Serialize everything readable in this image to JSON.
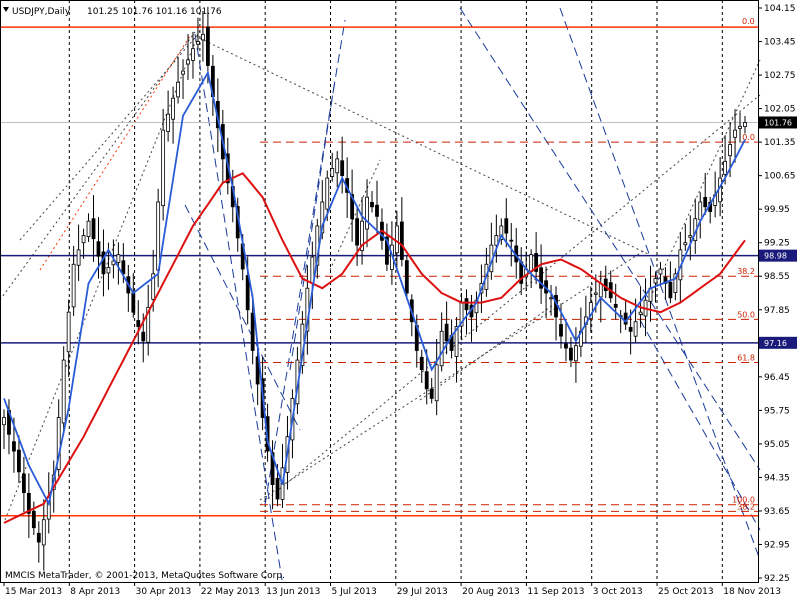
{
  "header": {
    "symbol": "USDJPY,Daily",
    "ohlc": "101.25 101.76 101.16 101.76"
  },
  "footer": {
    "copyright": "MMCIS MetaTrader, © 2001-2013, MetaQuotes Software Corp."
  },
  "colors": {
    "background": "#ffffff",
    "grid": "#000000",
    "candle": "#000000",
    "ma_fast": "#2a5bd7",
    "ma_slow": "#dd1111",
    "level_orange": "#ff3300",
    "level_navy": "#1a1a7a",
    "fibo_red": "#cc2200",
    "trend_blue": "#1a3a9a",
    "trend_dotted": "#444444"
  },
  "chart_data": {
    "type": "candlestick",
    "x_ticks": [
      "15 Mar 2013",
      "8 Apr 2013",
      "30 Apr 2013",
      "22 May 2013",
      "13 Jun 2013",
      "5 Jul 2013",
      "29 Jul 2013",
      "20 Aug 2013",
      "11 Sep 2013",
      "3 Oct 2013",
      "25 Oct 2013",
      "18 Nov 2013"
    ],
    "y_ticks": [
      "104.15",
      "103.45",
      "102.75",
      "102.05",
      "101.35",
      "100.65",
      "99.95",
      "99.25",
      "98.55",
      "97.85",
      "97.15",
      "96.45",
      "95.75",
      "95.05",
      "94.35",
      "93.65",
      "92.95",
      "92.25"
    ],
    "ylim": [
      92.25,
      104.15
    ],
    "current_price": "101.76",
    "price_badges": [
      {
        "label": "101.76",
        "value": 101.76,
        "color": "#000000"
      },
      {
        "label": "98.98",
        "value": 98.98,
        "color": "#1a1a7a"
      },
      {
        "label": "97.16",
        "value": 97.16,
        "color": "#1a1a7a"
      }
    ],
    "horizontal_levels": [
      {
        "value": 103.75,
        "color": "#ff3300",
        "style": "solid",
        "label": "0.0"
      },
      {
        "value": 93.55,
        "color": "#ff3300",
        "style": "solid",
        "label": ""
      },
      {
        "value": 98.98,
        "color": "#1a1a7a",
        "style": "solid",
        "label": ""
      },
      {
        "value": 97.16,
        "color": "#1a1a7a",
        "style": "solid",
        "label": ""
      }
    ],
    "fibo_levels": [
      {
        "value": 101.35,
        "label": "0.0"
      },
      {
        "value": 98.55,
        "label": "38.2"
      },
      {
        "value": 97.65,
        "label": "50.0"
      },
      {
        "value": 96.75,
        "label": "61.8"
      },
      {
        "value": 93.78,
        "label": "100.0"
      },
      {
        "value": 93.64,
        "label": "38.2"
      }
    ],
    "anchors": [
      [
        0,
        95.6
      ],
      [
        2,
        94.9
      ],
      [
        5,
        93.6
      ],
      [
        7,
        93.0
      ],
      [
        10,
        94.4
      ],
      [
        12,
        96.8
      ],
      [
        14,
        98.8
      ],
      [
        17,
        99.7
      ],
      [
        20,
        98.6
      ],
      [
        23,
        99.0
      ],
      [
        26,
        97.8
      ],
      [
        28,
        97.2
      ],
      [
        30,
        98.6
      ],
      [
        32,
        101.6
      ],
      [
        35,
        102.6
      ],
      [
        38,
        103.3
      ],
      [
        40,
        103.6
      ],
      [
        42,
        102.3
      ],
      [
        44,
        101.0
      ],
      [
        46,
        100.0
      ],
      [
        48,
        98.7
      ],
      [
        50,
        97.0
      ],
      [
        52,
        95.6
      ],
      [
        54,
        94.2
      ],
      [
        55,
        93.9
      ],
      [
        57,
        95.2
      ],
      [
        59,
        96.8
      ],
      [
        61,
        98.3
      ],
      [
        63,
        99.6
      ],
      [
        65,
        100.6
      ],
      [
        67,
        101.0
      ],
      [
        69,
        100.3
      ],
      [
        71,
        99.2
      ],
      [
        73,
        100.2
      ],
      [
        75,
        99.8
      ],
      [
        77,
        98.8
      ],
      [
        79,
        99.6
      ],
      [
        81,
        98.2
      ],
      [
        83,
        97.0
      ],
      [
        85,
        96.2
      ],
      [
        86,
        96.0
      ],
      [
        88,
        97.4
      ],
      [
        90,
        97.0
      ],
      [
        92,
        98.0
      ],
      [
        94,
        97.7
      ],
      [
        96,
        98.4
      ],
      [
        98,
        99.2
      ],
      [
        100,
        99.6
      ],
      [
        102,
        99.3
      ],
      [
        104,
        98.4
      ],
      [
        106,
        99.0
      ],
      [
        108,
        98.3
      ],
      [
        110,
        98.1
      ],
      [
        112,
        97.3
      ],
      [
        114,
        96.8
      ],
      [
        116,
        97.4
      ],
      [
        118,
        98.0
      ],
      [
        120,
        98.4
      ],
      [
        122,
        98.1
      ],
      [
        124,
        97.7
      ],
      [
        126,
        97.4
      ],
      [
        128,
        97.8
      ],
      [
        130,
        98.3
      ],
      [
        132,
        98.7
      ],
      [
        134,
        98.1
      ],
      [
        136,
        99.1
      ],
      [
        138,
        99.4
      ],
      [
        140,
        100.1
      ],
      [
        142,
        99.9
      ],
      [
        144,
        100.6
      ],
      [
        146,
        101.3
      ],
      [
        147,
        101.6
      ],
      [
        149,
        101.76
      ]
    ],
    "blue_anchors": [
      [
        0,
        96.0
      ],
      [
        5,
        94.6
      ],
      [
        9,
        93.8
      ],
      [
        13,
        95.8
      ],
      [
        17,
        98.4
      ],
      [
        21,
        99.1
      ],
      [
        26,
        98.2
      ],
      [
        31,
        98.6
      ],
      [
        36,
        101.9
      ],
      [
        41,
        102.8
      ],
      [
        46,
        100.4
      ],
      [
        50,
        98.1
      ],
      [
        53,
        95.1
      ],
      [
        56,
        94.2
      ],
      [
        60,
        96.9
      ],
      [
        64,
        99.6
      ],
      [
        68,
        100.6
      ],
      [
        72,
        99.8
      ],
      [
        77,
        99.3
      ],
      [
        82,
        97.8
      ],
      [
        86,
        96.6
      ],
      [
        90,
        97.3
      ],
      [
        95,
        98.0
      ],
      [
        100,
        99.4
      ],
      [
        105,
        98.7
      ],
      [
        110,
        98.2
      ],
      [
        115,
        97.2
      ],
      [
        120,
        98.1
      ],
      [
        125,
        97.6
      ],
      [
        130,
        98.3
      ],
      [
        135,
        98.5
      ],
      [
        140,
        99.7
      ],
      [
        145,
        100.6
      ],
      [
        149,
        101.4
      ]
    ],
    "red_anchors": [
      [
        0,
        93.4
      ],
      [
        8,
        93.8
      ],
      [
        16,
        95.2
      ],
      [
        24,
        96.8
      ],
      [
        32,
        98.4
      ],
      [
        38,
        99.6
      ],
      [
        44,
        100.5
      ],
      [
        48,
        100.7
      ],
      [
        52,
        100.2
      ],
      [
        56,
        99.3
      ],
      [
        60,
        98.5
      ],
      [
        64,
        98.3
      ],
      [
        68,
        98.6
      ],
      [
        72,
        99.2
      ],
      [
        76,
        99.5
      ],
      [
        80,
        99.2
      ],
      [
        84,
        98.6
      ],
      [
        88,
        98.2
      ],
      [
        92,
        98.0
      ],
      [
        96,
        98.0
      ],
      [
        100,
        98.1
      ],
      [
        104,
        98.5
      ],
      [
        108,
        98.8
      ],
      [
        112,
        98.9
      ],
      [
        116,
        98.7
      ],
      [
        120,
        98.4
      ],
      [
        124,
        98.1
      ],
      [
        128,
        97.9
      ],
      [
        132,
        97.8
      ],
      [
        136,
        98.0
      ],
      [
        140,
        98.3
      ],
      [
        144,
        98.6
      ],
      [
        149,
        99.3
      ]
    ]
  }
}
